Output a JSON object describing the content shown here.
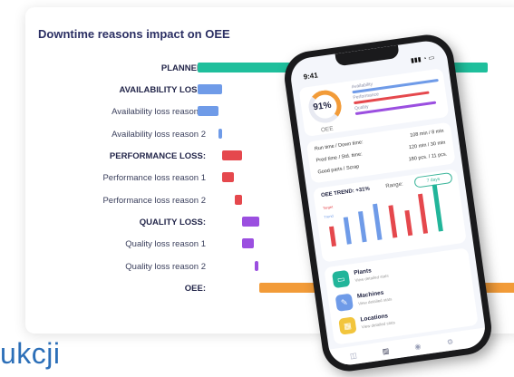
{
  "card": {
    "title": "Downtime reasons impact on OEE",
    "rows": [
      {
        "label": "PLANNED:",
        "bold": true
      },
      {
        "label": "AVAILABILITY LOSS:",
        "bold": true
      },
      {
        "label": "Availability loss reason 1",
        "bold": false
      },
      {
        "label": "Availability loss reason 2",
        "bold": false
      },
      {
        "label": "PERFORMANCE LOSS:",
        "bold": true
      },
      {
        "label": "Performance loss reason 1",
        "bold": false
      },
      {
        "label": "Performance loss reason 2",
        "bold": false
      },
      {
        "label": "QUALITY LOSS:",
        "bold": true
      },
      {
        "label": "Quality loss reason 1",
        "bold": false
      },
      {
        "label": "Quality loss reason 2",
        "bold": false
      },
      {
        "label": "OEE:",
        "bold": true
      }
    ]
  },
  "chart_data": {
    "type": "bar",
    "title": "Downtime reasons impact on OEE",
    "categories": [
      "PLANNED:",
      "AVAILABILITY LOSS:",
      "Availability loss reason 1",
      "Availability loss reason 2",
      "PERFORMANCE LOSS:",
      "Performance loss reason 1",
      "Performance loss reason 2",
      "QUALITY LOSS:",
      "Quality loss reason 1",
      "Quality loss reason 2",
      "OEE:"
    ],
    "colors": [
      "#1fbf9c",
      "#6f9be8",
      "#6f9be8",
      "#6f9be8",
      "#e5484d",
      "#e5484d",
      "#e5484d",
      "#9b4fe0",
      "#9b4fe0",
      "#9b4fe0",
      "#f29b38"
    ]
  },
  "bottom_text": "ukcji",
  "phone": {
    "time": "9:41",
    "status_icons": "▮▮▮ ◔ ▭",
    "oee_value": "91%",
    "oee_caption": "OEE",
    "mini_labels": [
      "Availability",
      "Performance",
      "Quality"
    ],
    "stats": [
      {
        "label": "Run time / Down time:",
        "value": "108 min / 8 min"
      },
      {
        "label": "Pred time / Std. time:",
        "value": "120 min / 30 min"
      },
      {
        "label": "Good parts / Scrap",
        "value": "180 pcs. / 11 pcs."
      }
    ],
    "trend_title": "OEE TREND: +31%",
    "range_label": "Range:",
    "range_value": "7 days",
    "target_label": "Target",
    "trend_label": "Trend",
    "nav": [
      {
        "title": "Plants",
        "sub": "View detailed stats",
        "color": "#22b59a",
        "icon": "▭"
      },
      {
        "title": "Machines",
        "sub": "View detailed stats",
        "color": "#6f9be8",
        "icon": "✎"
      },
      {
        "title": "Locations",
        "sub": "View detailed stats",
        "color": "#f2c53d",
        "icon": "▦"
      }
    ],
    "tabs": [
      "◫",
      "▥",
      "◉",
      "⚙"
    ]
  }
}
